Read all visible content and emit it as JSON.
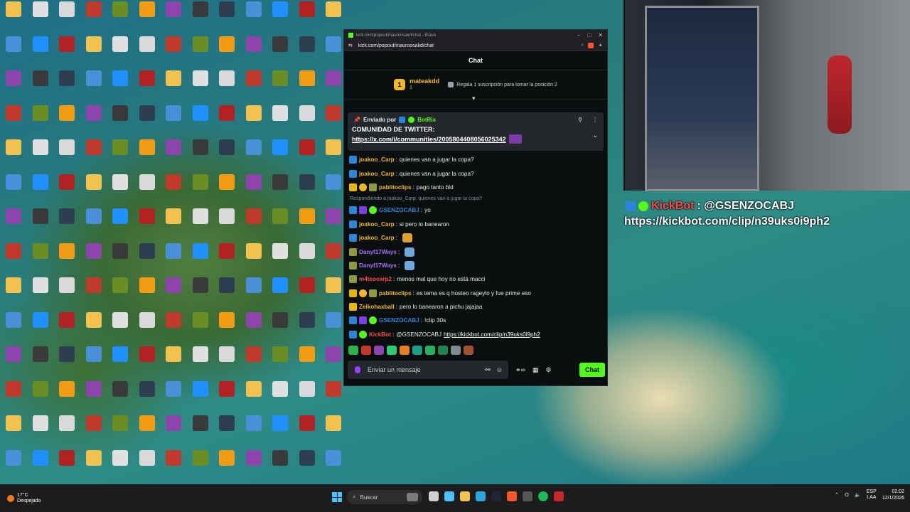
{
  "browser": {
    "title": "kick.com/popout/mauroosakd/chat - Brave",
    "url": "kick.com/popout/mauroosakd/chat"
  },
  "chat": {
    "header": "Chat",
    "leaderboard": {
      "rank": "1",
      "user": "mateakdd",
      "count": "1",
      "gift_text": "Regala 1 suscripción para tomar la posición 2"
    },
    "pinned": {
      "sent_by": "Enviado por",
      "bot_name": "BotRix",
      "line1": "COMUNIDAD DE TWITTER:",
      "link": "https://x.com/i/communities/2005804408056025342"
    },
    "messages": [
      {
        "type": "msg",
        "badges": [
          "blue"
        ],
        "user": "joakoo_Carp",
        "color": "#f2b824",
        "text": "quienes van a jugar la copa?"
      },
      {
        "type": "msg",
        "badges": [
          "blue"
        ],
        "user": "joakoo_Carp",
        "color": "#f2b824",
        "text": "quienes van a jugar la copa?"
      },
      {
        "type": "msg",
        "badges": [
          "gold",
          "orange",
          "olive"
        ],
        "user": "pablitoclips",
        "color": "#f2b824",
        "text": "pago tanto bld"
      },
      {
        "type": "reply",
        "text": "Respondiendo a joakoo_Carp: quienes van a jugar la copa?"
      },
      {
        "type": "msg",
        "badges": [
          "blue",
          "purple",
          "green"
        ],
        "user": "GSENZOCABJ",
        "color": "#2b86d9",
        "text": "yo"
      },
      {
        "type": "msg",
        "badges": [
          "blue"
        ],
        "user": "joakoo_Carp",
        "color": "#f2b824",
        "text": "si pero lo banearon"
      },
      {
        "type": "msg",
        "badges": [
          "blue"
        ],
        "user": "joakoo_Carp",
        "color": "#f2b824",
        "text": "",
        "emote": "#e0a030"
      },
      {
        "type": "msg",
        "badges": [
          "olive"
        ],
        "user": "Danyf17Ways",
        "color": "#a970ff",
        "text": "",
        "emote": "#6fa8dc"
      },
      {
        "type": "msg",
        "badges": [
          "olive"
        ],
        "user": "Danyf17Ways",
        "color": "#a970ff",
        "text": "",
        "emote": "#6fa8dc"
      },
      {
        "type": "msg",
        "badges": [
          "olive"
        ],
        "user": "m4teocarp2",
        "color": "#ff4a4a",
        "text": "menos mal que hoy no está macci"
      },
      {
        "type": "msg",
        "badges": [
          "gold",
          "orange",
          "olive"
        ],
        "user": "pablitoclips",
        "color": "#f2b824",
        "text": "es tema es q hosteo rageylo y fue prime eso"
      },
      {
        "type": "msg",
        "badges": [
          "gold"
        ],
        "user": "Zeikohaxball",
        "color": "#f2b824",
        "text": "pero lo banearon a pichu jajajaa"
      },
      {
        "type": "msg",
        "badges": [
          "blue",
          "purple",
          "green"
        ],
        "user": "GSENZOCABJ",
        "color": "#2b86d9",
        "text": "!clip 30s"
      },
      {
        "type": "msg",
        "badges": [
          "blue",
          "green"
        ],
        "user": "KickBot",
        "color": "#ff4a4a",
        "text": "@GSENZOCABJ",
        "link": "https://kickbot.com/clip/n39uks0i9ph2"
      }
    ],
    "composer": {
      "placeholder": "Enviar un mensaje",
      "send_label": "Chat"
    }
  },
  "overlay": {
    "bot": "KickBot",
    "mention": ": @GSENZOCABJ",
    "link": "https://kickbot.com/clip/n39uks0i9ph2"
  },
  "taskbar": {
    "weather_temp": "17°C",
    "weather_desc": "Despejado",
    "search_placeholder": "Buscar",
    "lang_top": "ESP",
    "lang_bottom": "LAA",
    "time": "02:02",
    "date": "12/1/2026"
  }
}
